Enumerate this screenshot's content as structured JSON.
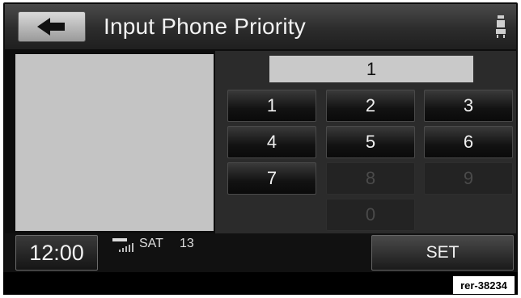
{
  "header": {
    "back_icon": "back-arrow-icon",
    "title": "Input Phone Priority",
    "seat_icon": "seat-icon"
  },
  "entry": {
    "value": "1"
  },
  "keypad": {
    "keys": [
      {
        "label": "1",
        "enabled": true
      },
      {
        "label": "2",
        "enabled": true
      },
      {
        "label": "3",
        "enabled": true
      },
      {
        "label": "4",
        "enabled": true
      },
      {
        "label": "5",
        "enabled": true
      },
      {
        "label": "6",
        "enabled": true
      },
      {
        "label": "7",
        "enabled": true
      },
      {
        "label": "8",
        "enabled": false
      },
      {
        "label": "9",
        "enabled": false
      },
      {
        "label": "0",
        "enabled": false
      }
    ]
  },
  "footer": {
    "clock": "12:00",
    "signal_icon": "signal-strength-icon",
    "source": "SAT",
    "channel": "13",
    "set_label": "SET"
  },
  "reference": "rer-38234"
}
